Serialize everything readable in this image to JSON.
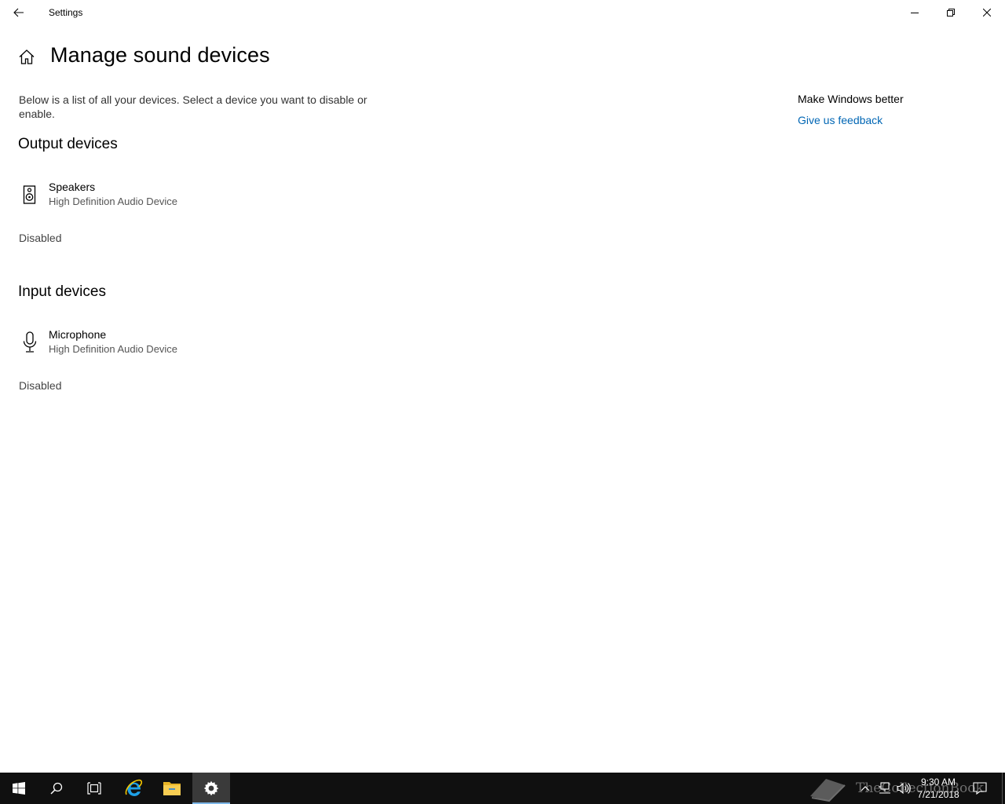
{
  "window": {
    "title": "Settings"
  },
  "page": {
    "title": "Manage sound devices",
    "description": "Below is a list of all your devices. Select a device you want to disable or enable."
  },
  "output_section": {
    "title": "Output devices",
    "devices": [
      {
        "name": "Speakers",
        "subtitle": "High Definition Audio Device",
        "status": "Disabled",
        "icon": "speaker-icon"
      }
    ]
  },
  "input_section": {
    "title": "Input devices",
    "devices": [
      {
        "name": "Microphone",
        "subtitle": "High Definition Audio Device",
        "status": "Disabled",
        "icon": "microphone-icon"
      }
    ]
  },
  "sidebar": {
    "title": "Make Windows better",
    "link": "Give us feedback"
  },
  "taskbar": {
    "time": "9:30 AM",
    "date": "7/21/2018",
    "watermark": "TheCollectionBook"
  },
  "colors": {
    "accent_link": "#0066b4",
    "taskbar": "#101010"
  }
}
